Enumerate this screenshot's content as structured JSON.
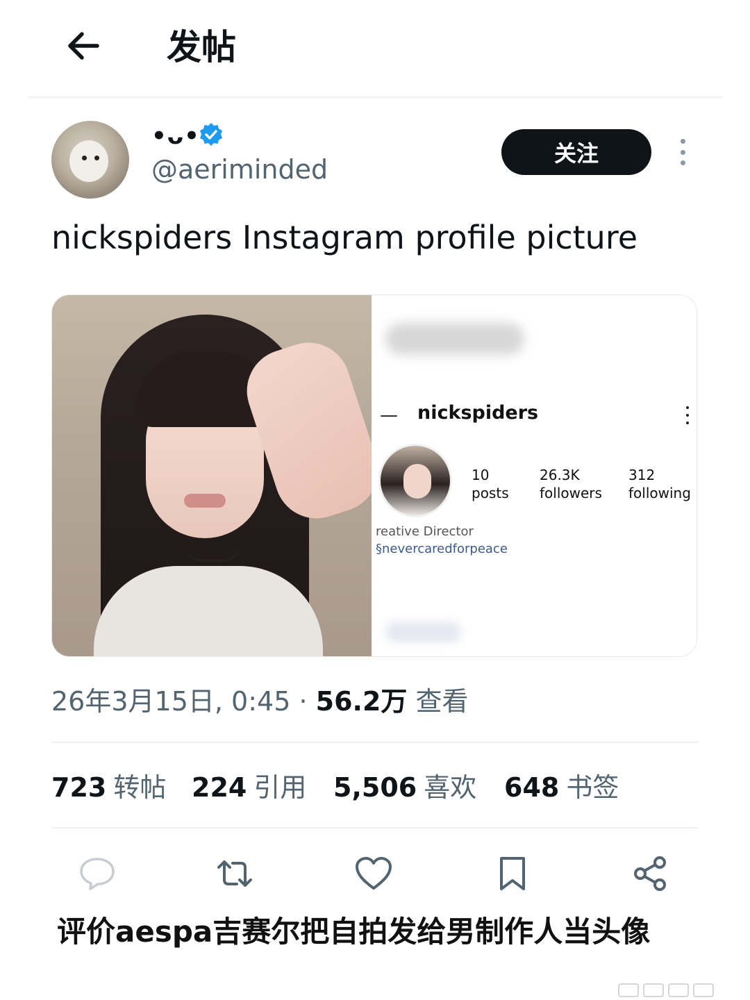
{
  "header": {
    "title": "发帖"
  },
  "author": {
    "display_name": "•ᴗ•",
    "handle": "@aeriminded",
    "follow_label": "关注"
  },
  "tweet": {
    "text": "nickspiders Instagram profile picture",
    "timestamp": "26年3月15日, 0:45 · ",
    "views_count": "56.2万",
    "views_label": " 查看"
  },
  "instagram_card": {
    "username": "nickspiders",
    "stats": [
      {
        "value": "10",
        "label": "posts"
      },
      {
        "value": "26.3K",
        "label": "followers"
      },
      {
        "value": "312",
        "label": "following"
      }
    ],
    "bio_line1": "reative Director",
    "bio_line2": "§nevercaredforpeace"
  },
  "engagement": {
    "reposts": {
      "value": "723",
      "label": "转帖"
    },
    "quotes": {
      "value": "224",
      "label": "引用"
    },
    "likes": {
      "value": "5,506",
      "label": "喜欢"
    },
    "bookmarks": {
      "value": "648",
      "label": "书签"
    }
  },
  "icons": [
    "back-arrow-icon",
    "verified-badge-icon",
    "more-icon",
    "reply-icon",
    "repost-icon",
    "like-icon",
    "bookmark-icon",
    "share-icon"
  ],
  "colors": {
    "verified": "#1d9bf0",
    "follow_bg": "#0f1419",
    "secondary_text": "#536471"
  },
  "caption": "评价aespa吉赛尔把自拍发给男制作人当头像"
}
